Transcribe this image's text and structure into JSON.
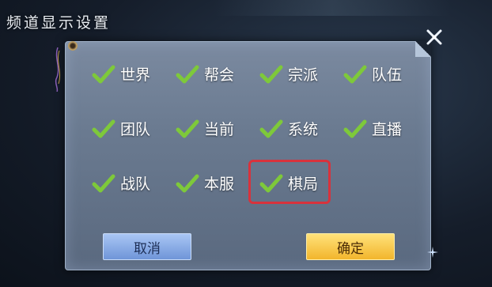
{
  "title": "频道显示设置",
  "channels": [
    {
      "label": "世界",
      "checked": true
    },
    {
      "label": "帮会",
      "checked": true
    },
    {
      "label": "宗派",
      "checked": true
    },
    {
      "label": "队伍",
      "checked": true
    },
    {
      "label": "团队",
      "checked": true
    },
    {
      "label": "当前",
      "checked": true
    },
    {
      "label": "系统",
      "checked": true
    },
    {
      "label": "直播",
      "checked": true
    },
    {
      "label": "战队",
      "checked": true
    },
    {
      "label": "本服",
      "checked": true
    },
    {
      "label": "棋局",
      "checked": true,
      "highlighted": true
    }
  ],
  "buttons": {
    "cancel": "取消",
    "confirm": "确定"
  },
  "colors": {
    "check": "#7ec93a",
    "highlight_border": "#d8323c",
    "confirm_button": "#f2b52c",
    "cancel_button": "#6f95d8"
  }
}
